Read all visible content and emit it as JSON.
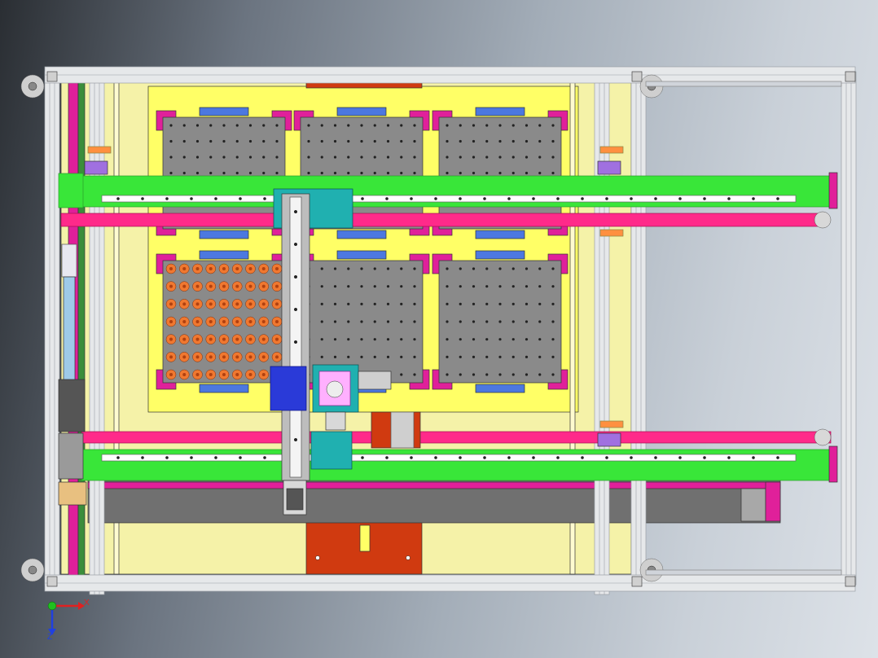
{
  "viewport": {
    "background_gradient": [
      "#2a2e33",
      "#6b7480",
      "#a3adb8",
      "#c9d0d8",
      "#dde2e8"
    ]
  },
  "colors": {
    "frame_aluminum": "#e6e8ea",
    "frame_edge": "#9aa0a6",
    "base_plate": "#f5f2a8",
    "yellow_plate": "#ffff66",
    "tray_gray": "#8a8a8a",
    "tray_corner_magenta": "#e0209a",
    "tray_tab_blue": "#4c78e0",
    "rail_green": "#39e639",
    "rail_dark": "#2a9a2a",
    "belt_pink": "#ff2a8a",
    "gantry_teal": "#20b0b0",
    "gripper_blue": "#2a3ad8",
    "part_orange": "#f07830",
    "red_plate": "#d03a10",
    "dark_beam": "#707070",
    "purple_bracket": "#a070e0"
  },
  "components": [
    {
      "name": "outer-frame",
      "icon": "aluminum-frame"
    },
    {
      "name": "extension-frame",
      "icon": "aluminum-frame"
    },
    {
      "name": "tray-top-left",
      "icon": "tray"
    },
    {
      "name": "tray-top-middle",
      "icon": "tray"
    },
    {
      "name": "tray-top-right",
      "icon": "tray"
    },
    {
      "name": "tray-bottom-left-loaded",
      "icon": "tray"
    },
    {
      "name": "tray-bottom-middle",
      "icon": "tray"
    },
    {
      "name": "tray-bottom-right",
      "icon": "tray"
    },
    {
      "name": "linear-rail-upper",
      "icon": "rail"
    },
    {
      "name": "linear-rail-lower",
      "icon": "rail"
    },
    {
      "name": "belt-upper",
      "icon": "belt"
    },
    {
      "name": "belt-lower",
      "icon": "belt"
    },
    {
      "name": "gantry-y-axis",
      "icon": "gantry"
    },
    {
      "name": "gripper-head",
      "icon": "gripper"
    }
  ],
  "triad": {
    "x_label": "X",
    "z_label": "Z",
    "x_color": "#e02020",
    "z_color": "#2040e0",
    "origin_color": "#20c020"
  }
}
